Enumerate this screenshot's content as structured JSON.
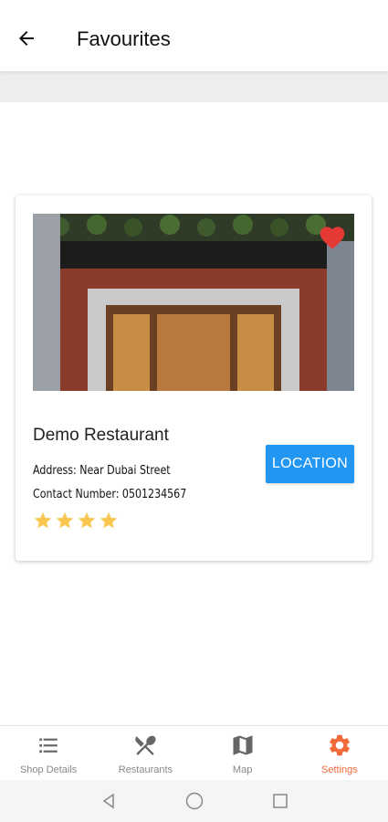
{
  "header": {
    "title": "Favourites"
  },
  "card": {
    "name": "Demo Restaurant",
    "address": "Address: Near Dubai Street",
    "contact": "Contact Number: 0501234567",
    "rating": 4,
    "favourited": true,
    "location_button": "LOCATION"
  },
  "bottom_nav": {
    "items": [
      {
        "label": "Shop Details",
        "icon": "list-icon"
      },
      {
        "label": "Restaurants",
        "icon": "fork-knife-icon"
      },
      {
        "label": "Map",
        "icon": "map-icon"
      },
      {
        "label": "Settings",
        "icon": "gear-icon"
      }
    ],
    "active": "Settings"
  },
  "colors": {
    "accent": "#2196f3",
    "active_nav": "#f06a3b",
    "heart": "#e53935",
    "star": "#f9c74f"
  }
}
